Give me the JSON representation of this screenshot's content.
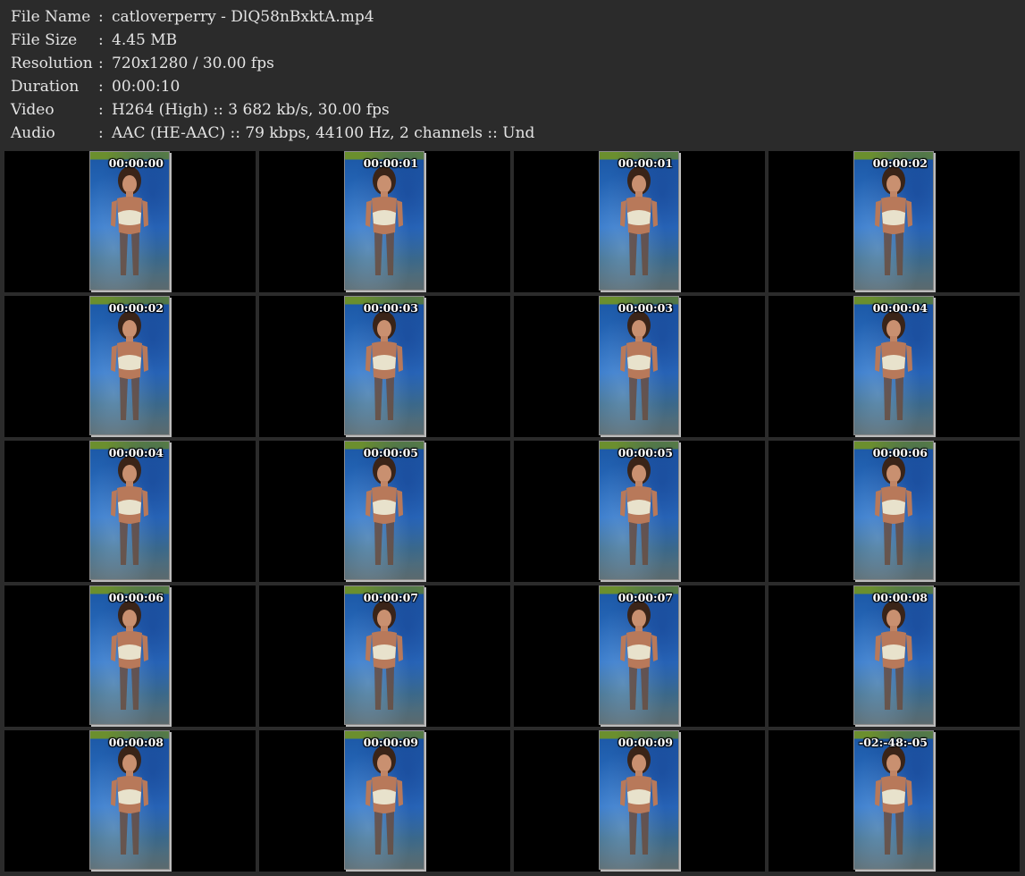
{
  "info": [
    {
      "label": "File Name",
      "colon": ":",
      "value": "catloverperry - DlQ58nBxktA.mp4"
    },
    {
      "label": "File Size",
      "colon": ":",
      "value": "4.45 MB"
    },
    {
      "label": "Resolution",
      "colon": ":",
      "value": "720x1280 / 30.00 fps"
    },
    {
      "label": "Duration",
      "colon": ":",
      "value": "00:00:10"
    },
    {
      "label": "Video",
      "colon": ":",
      "value": "H264 (High) :: 3 682 kb/s, 30.00 fps"
    },
    {
      "label": "Audio",
      "colon": ":",
      "value": "AAC (HE-AAC) :: 79 kbps, 44100 Hz, 2 channels :: Und"
    }
  ],
  "thumbnails": [
    {
      "timestamp": "00:00:00"
    },
    {
      "timestamp": "00:00:01"
    },
    {
      "timestamp": "00:00:01"
    },
    {
      "timestamp": "00:00:02"
    },
    {
      "timestamp": "00:00:02"
    },
    {
      "timestamp": "00:00:03"
    },
    {
      "timestamp": "00:00:03"
    },
    {
      "timestamp": "00:00:04"
    },
    {
      "timestamp": "00:00:04"
    },
    {
      "timestamp": "00:00:05"
    },
    {
      "timestamp": "00:00:05"
    },
    {
      "timestamp": "00:00:06"
    },
    {
      "timestamp": "00:00:06"
    },
    {
      "timestamp": "00:00:07"
    },
    {
      "timestamp": "00:00:07"
    },
    {
      "timestamp": "00:00:08"
    },
    {
      "timestamp": "00:00:08"
    },
    {
      "timestamp": "00:00:09"
    },
    {
      "timestamp": "00:00:09"
    },
    {
      "timestamp": "-02:-48:-05"
    }
  ],
  "colors": {
    "background": "#2b2b2b",
    "text": "#e4e4e4",
    "cell_background": "#000000"
  }
}
